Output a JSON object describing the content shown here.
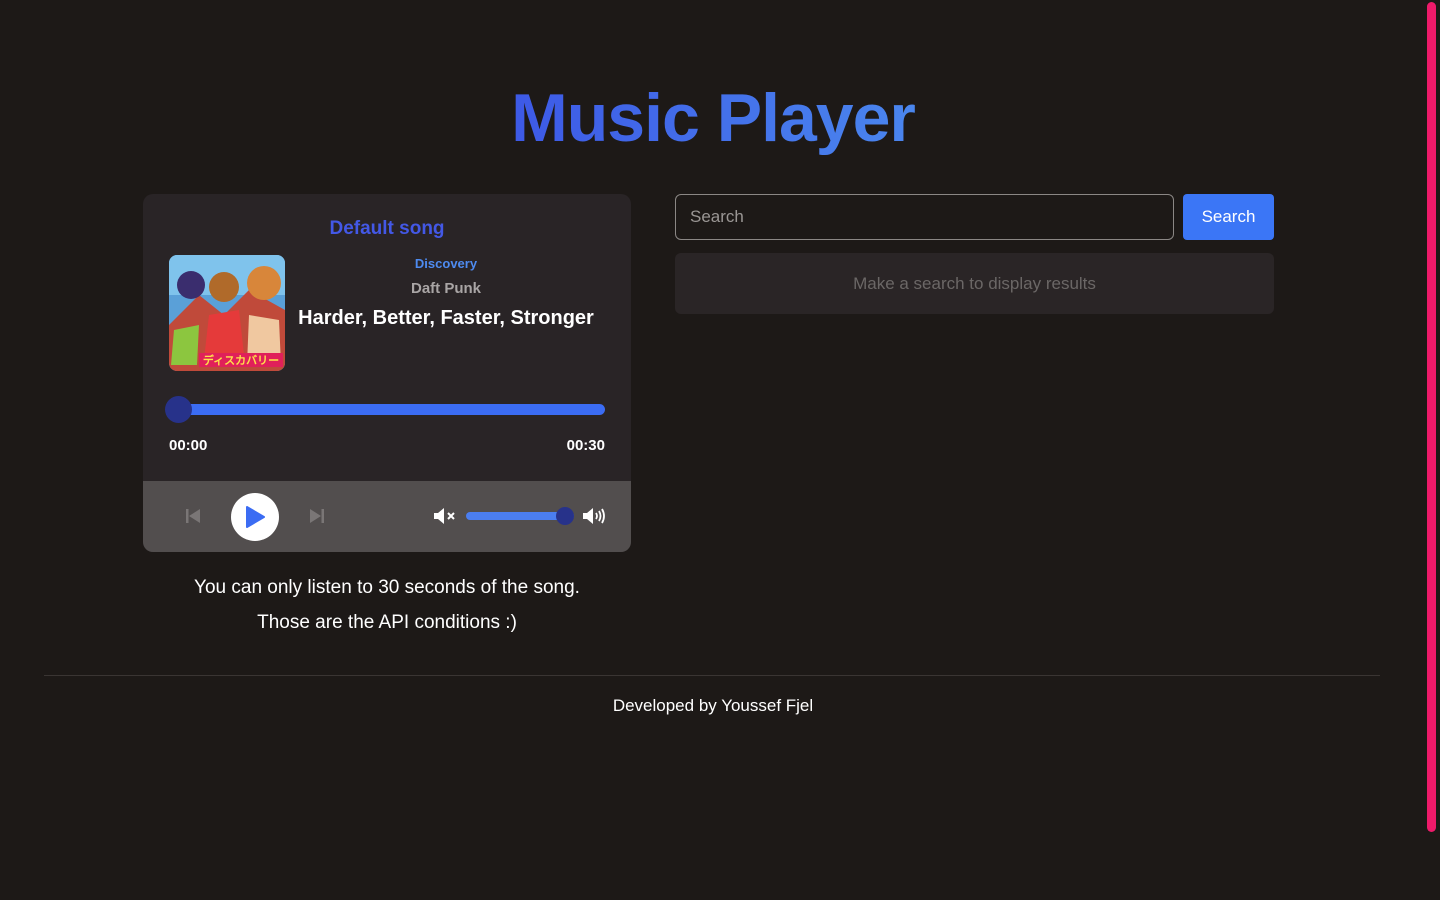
{
  "header": {
    "title": "Music Player"
  },
  "player": {
    "label": "Default song",
    "album": "Discovery",
    "artist": "Daft Punk",
    "song": "Harder, Better, Faster, Stronger",
    "current_time": "00:00",
    "total_time": "00:30",
    "progress": 0,
    "volume": 1,
    "accent_color": "#3b6cf3"
  },
  "notes": {
    "line1": "You can only listen to 30 seconds of the song.",
    "line2": "Those are the API conditions :)"
  },
  "search": {
    "placeholder": "Search",
    "button_label": "Search",
    "empty_message": "Make a search to display results"
  },
  "footer": {
    "text": "Developed by Youssef Fjel"
  },
  "icons": {
    "prev": "skip-previous-icon",
    "play": "play-icon",
    "next": "skip-next-icon",
    "mute": "volume-mute-icon",
    "volume": "volume-up-icon"
  }
}
